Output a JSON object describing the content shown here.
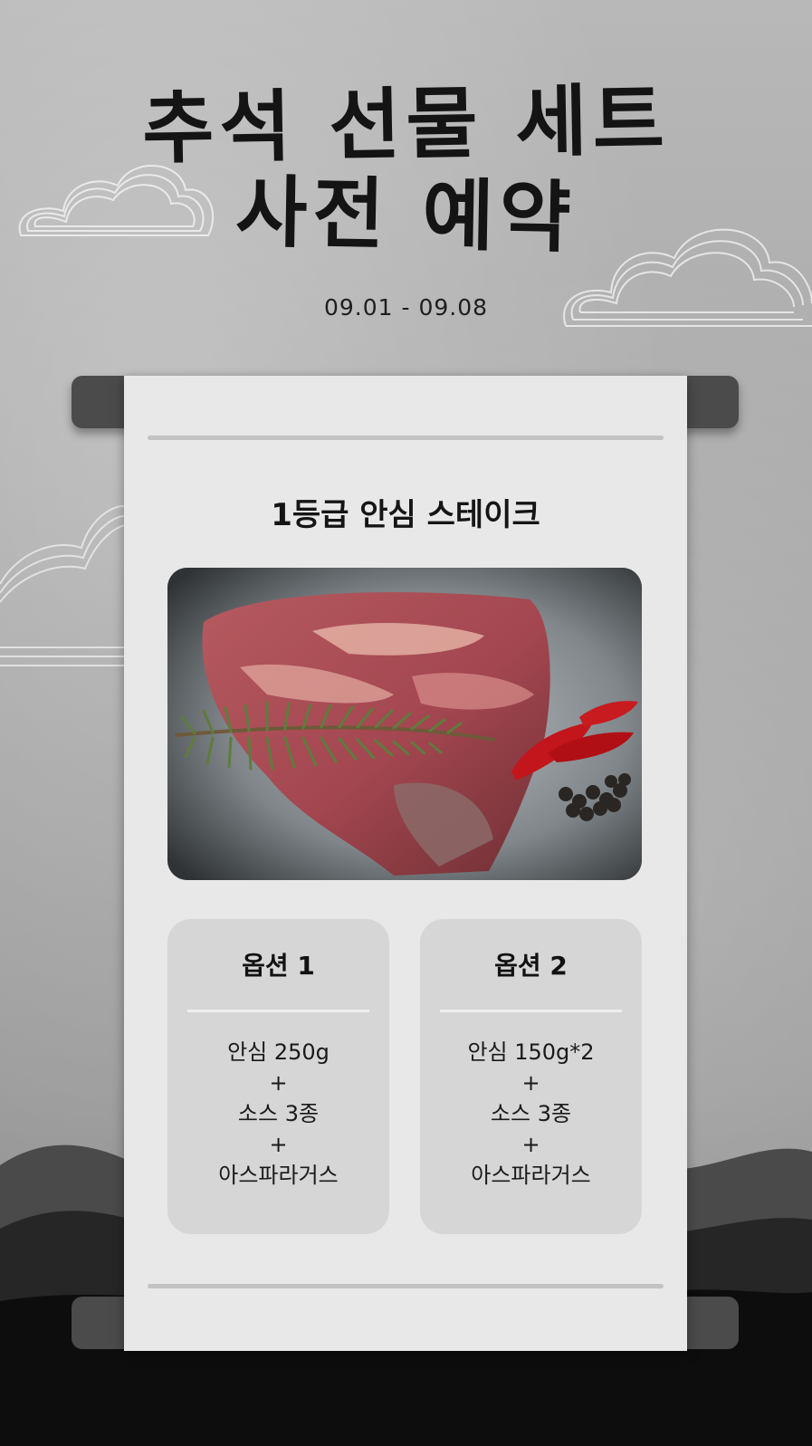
{
  "header": {
    "title_line1": "추석 선물 세트",
    "title_line2": "사전 예약",
    "date_range": "09.01 - 09.08"
  },
  "product": {
    "name": "1등급 안심 스테이크"
  },
  "options": [
    {
      "title": "옵션 1",
      "lines": [
        "안심 250g",
        "+",
        "소스 3종",
        "+",
        "아스파라거스"
      ]
    },
    {
      "title": "옵션 2",
      "lines": [
        "안심 150g*2",
        "+",
        "소스 3종",
        "+",
        "아스파라거스"
      ]
    }
  ],
  "colors": {
    "background": "#a9a9a9",
    "paper": "#e8e8e8",
    "rod": "#4b4b4b",
    "option_card": "#d6d6d6",
    "ink": "#141414"
  }
}
